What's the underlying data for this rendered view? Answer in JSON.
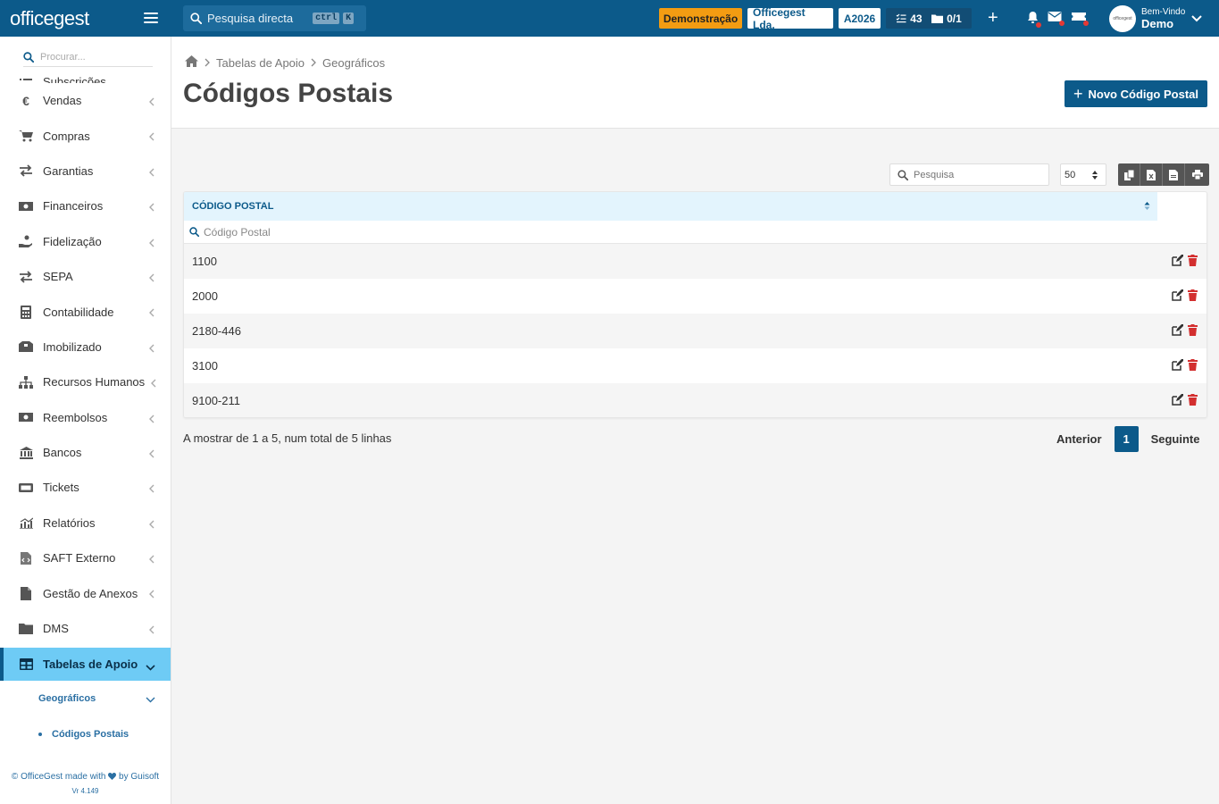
{
  "app": {
    "logo": "officegest",
    "global_search_placeholder": "Pesquisa directa",
    "kbd_ctrl": "ctrl",
    "kbd_k": "K"
  },
  "topbar": {
    "demo_badge": "Demonstração",
    "company": "Officegest Lda.",
    "year": "A2026",
    "tasks_count": "43",
    "folders_count": "0/1",
    "welcome_label": "Bem-Vindo",
    "user_name": "Demo",
    "avatar_text": "officegest",
    "icons": [
      "menu-icon",
      "search-icon",
      "tasks-icon",
      "folder-icon",
      "plus-icon",
      "bell-icon",
      "mail-icon",
      "ticket-icon",
      "chevron-down-icon"
    ]
  },
  "sidebar": {
    "search_placeholder": "Procurar...",
    "items": [
      {
        "label": "Subscrições",
        "icon": "list-icon"
      },
      {
        "label": "Vendas",
        "icon": "euro-icon"
      },
      {
        "label": "Compras",
        "icon": "cart-icon"
      },
      {
        "label": "Garantias",
        "icon": "exchange-icon"
      },
      {
        "label": "Financeiros",
        "icon": "money-icon"
      },
      {
        "label": "Fidelização",
        "icon": "hand-coin-icon"
      },
      {
        "label": "SEPA",
        "icon": "exchange-icon"
      },
      {
        "label": "Contabilidade",
        "icon": "calculator-icon"
      },
      {
        "label": "Imobilizado",
        "icon": "boxes-icon"
      },
      {
        "label": "Recursos Humanos",
        "icon": "org-chart-icon"
      },
      {
        "label": "Reembolsos",
        "icon": "money-icon"
      },
      {
        "label": "Bancos",
        "icon": "bank-icon"
      },
      {
        "label": "Tickets",
        "icon": "ticket-icon"
      },
      {
        "label": "Relatórios",
        "icon": "chart-icon"
      },
      {
        "label": "SAFT Externo",
        "icon": "file-code-icon"
      },
      {
        "label": "Gestão de Anexos",
        "icon": "file-icon"
      },
      {
        "label": "DMS",
        "icon": "folder-icon"
      }
    ],
    "active_item": {
      "label": "Tabelas de Apoio",
      "icon": "table-icon"
    },
    "sub_item": "Geográficos",
    "subsub_item": "Códigos Postais",
    "footer_text_1": "© OfficeGest made with",
    "footer_text_2": "by Guisoft",
    "version": "Vr 4.149"
  },
  "header": {
    "breadcrumb": [
      "Tabelas de Apoio",
      "Geográficos"
    ],
    "title": "Códigos Postais",
    "new_button": "Novo Código Postal"
  },
  "table": {
    "search_placeholder": "Pesquisa",
    "page_size": "50",
    "column_header": "Código Postal",
    "filter_placeholder": "Código Postal",
    "rows": [
      "1100",
      "2000",
      "2180-446",
      "3100",
      "9100-211"
    ],
    "export_icons": [
      "copy-icon",
      "excel-icon",
      "pdf-icon",
      "print-icon"
    ],
    "row_action_icons": [
      "edit-icon",
      "delete-icon"
    ]
  },
  "pagination": {
    "info": "A mostrar de 1 a 5, num total de 5 linhas",
    "previous": "Anterior",
    "current_page": "1",
    "next": "Seguinte"
  },
  "colors": {
    "primary": "#0c5a8a",
    "active_menu": "#6ecbf5",
    "header_row": "#e3f4fd",
    "demo_badge": "#f39c12",
    "delete": "#d32f2f"
  }
}
